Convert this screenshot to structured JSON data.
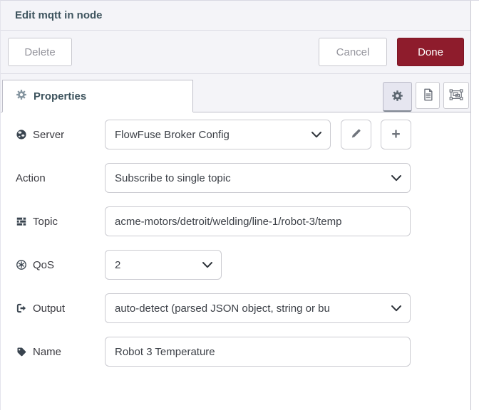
{
  "dialog": {
    "title": "Edit mqtt in node"
  },
  "header_buttons": {
    "delete": "Delete",
    "cancel": "Cancel",
    "done": "Done"
  },
  "tabs": {
    "properties": "Properties"
  },
  "toolbar": {
    "settings_icon": "gear-icon",
    "description_icon": "description-icon",
    "appearance_icon": "object-group-icon"
  },
  "form": {
    "server": {
      "label": "Server",
      "icon": "globe-icon",
      "value": "FlowFuse Broker Config"
    },
    "action": {
      "label": "Action",
      "value": "Subscribe to single topic"
    },
    "topic": {
      "label": "Topic",
      "icon": "tasks-icon",
      "value": "acme-motors/detroit/welding/line-1/robot-3/temp"
    },
    "qos": {
      "label": "QoS",
      "icon": "circled-asterisk-icon",
      "value": "2"
    },
    "output": {
      "label": "Output",
      "icon": "sign-out-icon",
      "value": "auto-detect (parsed JSON object, string or bu"
    },
    "name": {
      "label": "Name",
      "icon": "tag-icon",
      "value": "Robot 3 Temperature"
    }
  },
  "row_buttons": {
    "edit_icon": "pencil-icon",
    "add_icon": "plus-icon",
    "add_label": "+"
  },
  "colors": {
    "done_button": "#8e1c2c",
    "panel_bg": "#f4f4f8",
    "tab_text": "#3e545e",
    "input_border": "#cbcbd1",
    "tab_border": "#bfbfc9",
    "icon_dark": "#39444f"
  }
}
